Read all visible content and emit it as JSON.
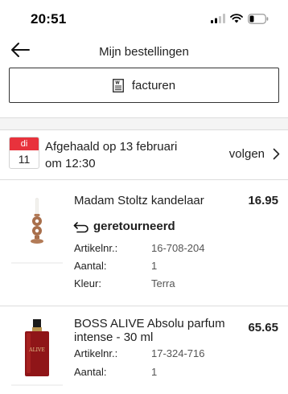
{
  "status_bar": {
    "time": "20:51"
  },
  "nav": {
    "title": "Mijn bestellingen"
  },
  "invoices_button": {
    "label": "facturen"
  },
  "delivery": {
    "calendar_day": "di",
    "calendar_date": "11",
    "status": "Afgehaald op 13 februari",
    "time": "om 12:30",
    "track_label": "volgen"
  },
  "items": [
    {
      "name": "Madam Stoltz kandelaar",
      "price": "16.95",
      "returned_label": "geretourneerd",
      "attributes": [
        {
          "label": "Artikelnr.:",
          "value": "16-708-204"
        },
        {
          "label": "Aantal:",
          "value": "1"
        },
        {
          "label": "Kleur:",
          "value": "Terra"
        }
      ]
    },
    {
      "name": "BOSS ALIVE Absolu parfum intense - 30 ml",
      "price": "65.65",
      "bottle_text": "ALIVE",
      "attributes": [
        {
          "label": "Artikelnr.:",
          "value": "17-324-716"
        },
        {
          "label": "Aantal:",
          "value": "1"
        }
      ]
    }
  ],
  "colors": {
    "calendar_red": "#e8323c",
    "text": "#1f1f1f",
    "band": "#f4f4f4"
  }
}
